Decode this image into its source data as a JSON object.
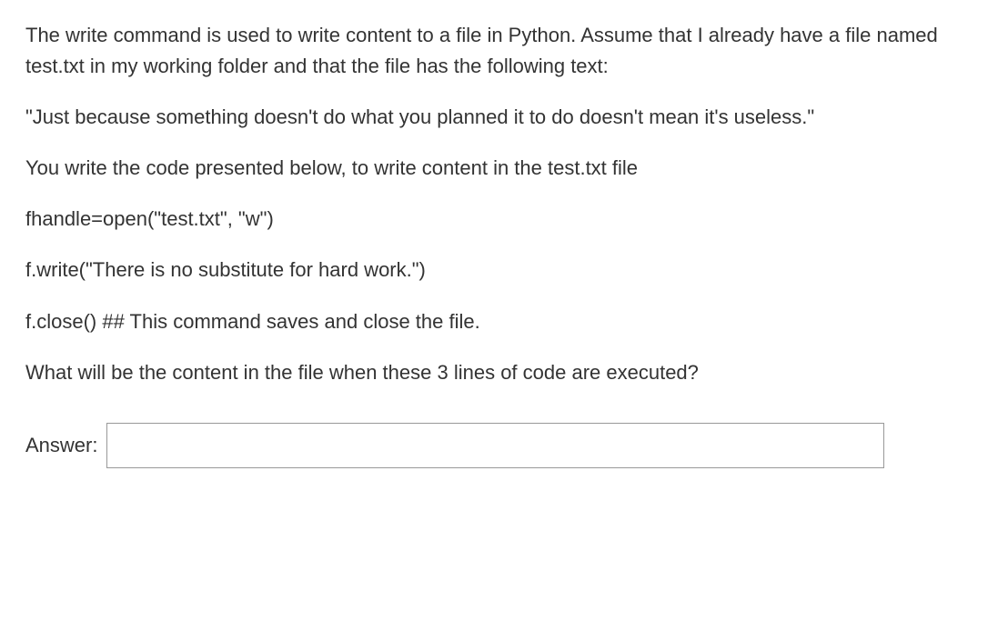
{
  "question": {
    "para1": "The write command is used to write content to a file in Python. Assume that I already have a file named test.txt in my working folder and that the file has the following text:",
    "para2": "\"Just because something doesn't do what you planned it to do doesn't mean it's useless.\"",
    "para3": "You write the code presented below, to write content in the test.txt file",
    "code1": "fhandle=open(\"test.txt\", \"w\")",
    "code2": "f.write(\"There is no substitute for hard work.\")",
    "code3": "f.close()   ## This command saves and close the file.",
    "para4": "What will be the content in the file when these 3 lines of code are executed?"
  },
  "answer": {
    "label": "Answer:",
    "value": ""
  }
}
